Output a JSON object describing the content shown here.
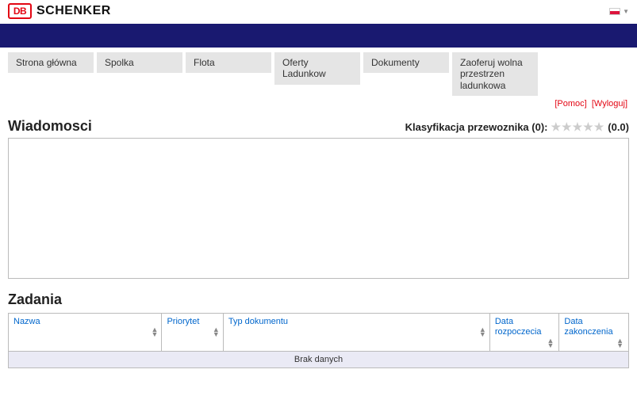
{
  "header": {
    "logo_db": "DB",
    "logo_text": "SCHENKER"
  },
  "nav": {
    "tabs": [
      "Strona główna",
      "Spolka",
      "Flota",
      "Oferty Ladunkow",
      "Dokumenty",
      "Zaoferuj wolna przestrzen ladunkowa"
    ]
  },
  "util": {
    "help": "[Pomoc]",
    "logout": "[Wyloguj]"
  },
  "messages": {
    "title": "Wiadomosci"
  },
  "classification": {
    "label": "Klasyfikacja przewoznika (0):",
    "score": "(0.0)"
  },
  "tasks": {
    "title": "Zadania",
    "columns": {
      "name": "Nazwa",
      "priority": "Priorytet",
      "doctype": "Typ dokumentu",
      "start": "Data rozpoczecia",
      "end": "Data zakonczenia"
    },
    "no_data": "Brak danych"
  }
}
